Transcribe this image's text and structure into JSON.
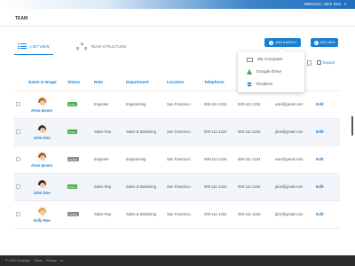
{
  "topbar": {
    "welcome": "Welcome, John Doe",
    "caret": "▾"
  },
  "header": {
    "title": "TEAM"
  },
  "tabs": [
    {
      "label": "LIST VIEW",
      "active": true,
      "icon": "list-icon"
    },
    {
      "label": "TEAM STRUCTURE",
      "active": false,
      "icon": "org-chart-icon"
    }
  ],
  "buttons": {
    "add_batch": "ADD A BATCH",
    "add_new": "ADD NEW",
    "plus": "+"
  },
  "dropdown": {
    "items": [
      {
        "label": "My Computer",
        "icon": "computer-icon"
      },
      {
        "label": "Google Drive",
        "icon": "google-drive-icon"
      },
      {
        "label": "Dropbox",
        "icon": "dropbox-icon"
      }
    ]
  },
  "toolbar": {
    "partial_label": "S",
    "export": "Export"
  },
  "table": {
    "columns": [
      "Name & Image",
      "Status",
      "Role",
      "Department",
      "Location",
      "Telephone",
      "",
      "ress",
      ""
    ],
    "rows": [
      {
        "name": "Anna Ipsum",
        "status": "Active",
        "role": "Engineer",
        "department": "Engineering",
        "location": "San Francisco",
        "telephone": "000-111-1234",
        "phone2": "000-111-1234",
        "email": "user@gmail.com",
        "action": "Edit",
        "hair": "#b5651d"
      },
      {
        "name": "John Doe",
        "status": "Active",
        "role": "Sales Rep",
        "department": "Sales & Marketing",
        "location": "San Francisco",
        "telephone": "000-111-1234",
        "phone2": "000-111-1234",
        "email": "jdoe@gmail.com",
        "action": "Edit",
        "hair": "#3a2a1f"
      },
      {
        "name": "Anna Ipsum",
        "status": "Inactive",
        "role": "Engineer",
        "department": "Engineering",
        "location": "San Francisco",
        "telephone": "000-111-1234",
        "phone2": "000-111-1234",
        "email": "user@gmail.com",
        "action": "Edit",
        "hair": "#a0522d"
      },
      {
        "name": "John Doe",
        "status": "Active",
        "role": "Sales Rep",
        "department": "Sales & Marketing",
        "location": "San Francisco",
        "telephone": "000-111-1234",
        "phone2": "000-111-1234",
        "email": "jdoe@gmail.com",
        "action": "Edit",
        "hair": "#2e2018"
      },
      {
        "name": "Sally Mae",
        "status": "Inactive",
        "role": "Sales Rep",
        "department": "Sales & Marketing",
        "location": "San Francisco",
        "telephone": "000-111-1234",
        "phone2": "000-111-1234",
        "email": "jdoe@gmail.com",
        "action": "Edit",
        "hair": "#d9a441"
      }
    ]
  },
  "footer": {
    "copyright": "© 2016 Company",
    "terms": "Terms",
    "privacy": "Privacy",
    "more": "•••"
  },
  "colors": {
    "accent": "#1a7fd2",
    "active": "#4cae4c",
    "inactive": "#8a8a8a",
    "footer": "#2b2b2b"
  }
}
